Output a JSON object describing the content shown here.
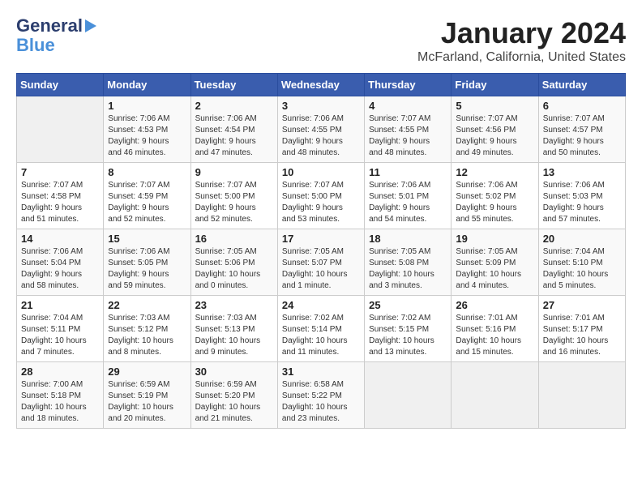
{
  "header": {
    "logo_general": "General",
    "logo_blue": "Blue",
    "month_year": "January 2024",
    "location": "McFarland, California, United States"
  },
  "days_of_week": [
    "Sunday",
    "Monday",
    "Tuesday",
    "Wednesday",
    "Thursday",
    "Friday",
    "Saturday"
  ],
  "weeks": [
    [
      {
        "day": "",
        "info": ""
      },
      {
        "day": "1",
        "info": "Sunrise: 7:06 AM\nSunset: 4:53 PM\nDaylight: 9 hours\nand 46 minutes."
      },
      {
        "day": "2",
        "info": "Sunrise: 7:06 AM\nSunset: 4:54 PM\nDaylight: 9 hours\nand 47 minutes."
      },
      {
        "day": "3",
        "info": "Sunrise: 7:06 AM\nSunset: 4:55 PM\nDaylight: 9 hours\nand 48 minutes."
      },
      {
        "day": "4",
        "info": "Sunrise: 7:07 AM\nSunset: 4:55 PM\nDaylight: 9 hours\nand 48 minutes."
      },
      {
        "day": "5",
        "info": "Sunrise: 7:07 AM\nSunset: 4:56 PM\nDaylight: 9 hours\nand 49 minutes."
      },
      {
        "day": "6",
        "info": "Sunrise: 7:07 AM\nSunset: 4:57 PM\nDaylight: 9 hours\nand 50 minutes."
      }
    ],
    [
      {
        "day": "7",
        "info": "Sunrise: 7:07 AM\nSunset: 4:58 PM\nDaylight: 9 hours\nand 51 minutes."
      },
      {
        "day": "8",
        "info": "Sunrise: 7:07 AM\nSunset: 4:59 PM\nDaylight: 9 hours\nand 52 minutes."
      },
      {
        "day": "9",
        "info": "Sunrise: 7:07 AM\nSunset: 5:00 PM\nDaylight: 9 hours\nand 52 minutes."
      },
      {
        "day": "10",
        "info": "Sunrise: 7:07 AM\nSunset: 5:00 PM\nDaylight: 9 hours\nand 53 minutes."
      },
      {
        "day": "11",
        "info": "Sunrise: 7:06 AM\nSunset: 5:01 PM\nDaylight: 9 hours\nand 54 minutes."
      },
      {
        "day": "12",
        "info": "Sunrise: 7:06 AM\nSunset: 5:02 PM\nDaylight: 9 hours\nand 55 minutes."
      },
      {
        "day": "13",
        "info": "Sunrise: 7:06 AM\nSunset: 5:03 PM\nDaylight: 9 hours\nand 57 minutes."
      }
    ],
    [
      {
        "day": "14",
        "info": "Sunrise: 7:06 AM\nSunset: 5:04 PM\nDaylight: 9 hours\nand 58 minutes."
      },
      {
        "day": "15",
        "info": "Sunrise: 7:06 AM\nSunset: 5:05 PM\nDaylight: 9 hours\nand 59 minutes."
      },
      {
        "day": "16",
        "info": "Sunrise: 7:05 AM\nSunset: 5:06 PM\nDaylight: 10 hours\nand 0 minutes."
      },
      {
        "day": "17",
        "info": "Sunrise: 7:05 AM\nSunset: 5:07 PM\nDaylight: 10 hours\nand 1 minute."
      },
      {
        "day": "18",
        "info": "Sunrise: 7:05 AM\nSunset: 5:08 PM\nDaylight: 10 hours\nand 3 minutes."
      },
      {
        "day": "19",
        "info": "Sunrise: 7:05 AM\nSunset: 5:09 PM\nDaylight: 10 hours\nand 4 minutes."
      },
      {
        "day": "20",
        "info": "Sunrise: 7:04 AM\nSunset: 5:10 PM\nDaylight: 10 hours\nand 5 minutes."
      }
    ],
    [
      {
        "day": "21",
        "info": "Sunrise: 7:04 AM\nSunset: 5:11 PM\nDaylight: 10 hours\nand 7 minutes."
      },
      {
        "day": "22",
        "info": "Sunrise: 7:03 AM\nSunset: 5:12 PM\nDaylight: 10 hours\nand 8 minutes."
      },
      {
        "day": "23",
        "info": "Sunrise: 7:03 AM\nSunset: 5:13 PM\nDaylight: 10 hours\nand 9 minutes."
      },
      {
        "day": "24",
        "info": "Sunrise: 7:02 AM\nSunset: 5:14 PM\nDaylight: 10 hours\nand 11 minutes."
      },
      {
        "day": "25",
        "info": "Sunrise: 7:02 AM\nSunset: 5:15 PM\nDaylight: 10 hours\nand 13 minutes."
      },
      {
        "day": "26",
        "info": "Sunrise: 7:01 AM\nSunset: 5:16 PM\nDaylight: 10 hours\nand 15 minutes."
      },
      {
        "day": "27",
        "info": "Sunrise: 7:01 AM\nSunset: 5:17 PM\nDaylight: 10 hours\nand 16 minutes."
      }
    ],
    [
      {
        "day": "28",
        "info": "Sunrise: 7:00 AM\nSunset: 5:18 PM\nDaylight: 10 hours\nand 18 minutes."
      },
      {
        "day": "29",
        "info": "Sunrise: 6:59 AM\nSunset: 5:19 PM\nDaylight: 10 hours\nand 20 minutes."
      },
      {
        "day": "30",
        "info": "Sunrise: 6:59 AM\nSunset: 5:20 PM\nDaylight: 10 hours\nand 21 minutes."
      },
      {
        "day": "31",
        "info": "Sunrise: 6:58 AM\nSunset: 5:22 PM\nDaylight: 10 hours\nand 23 minutes."
      },
      {
        "day": "",
        "info": ""
      },
      {
        "day": "",
        "info": ""
      },
      {
        "day": "",
        "info": ""
      }
    ]
  ]
}
